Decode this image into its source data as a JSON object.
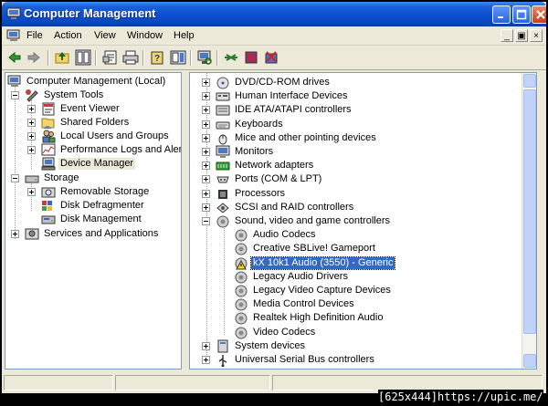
{
  "window": {
    "title": "Computer Management"
  },
  "menu": {
    "items": [
      "File",
      "Action",
      "View",
      "Window",
      "Help"
    ]
  },
  "tree": {
    "root": "Computer Management (Local)",
    "system_tools": "System Tools",
    "event_viewer": "Event Viewer",
    "shared_folders": "Shared Folders",
    "local_users": "Local Users and Groups",
    "perf_logs": "Performance Logs and Alerts",
    "device_manager": "Device Manager",
    "storage": "Storage",
    "removable_storage": "Removable Storage",
    "disk_defrag": "Disk Defragmenter",
    "disk_mgmt": "Disk Management",
    "services_apps": "Services and Applications"
  },
  "devices": {
    "categories": [
      "DVD/CD-ROM drives",
      "Human Interface Devices",
      "IDE ATA/ATAPI controllers",
      "Keyboards",
      "Mice and other pointing devices",
      "Monitors",
      "Network adapters",
      "Ports (COM & LPT)",
      "Processors",
      "SCSI and RAID controllers",
      "Sound, video and game controllers"
    ],
    "sound_children": [
      "Audio Codecs",
      "Creative SBLive! Gameport",
      "kX 10k1 Audio (3550) - Generic",
      "Legacy Audio Drivers",
      "Legacy Video Capture Devices",
      "Media Control Devices",
      "Realtek High Definition Audio",
      "Video Codecs"
    ],
    "after": [
      "System devices",
      "Universal Serial Bus controllers"
    ]
  },
  "watermark": "[625x444]https://upic.me/",
  "icons": [
    "app-icon",
    "minimize-icon",
    "maximize-icon",
    "close-icon",
    "back-icon",
    "forward-icon",
    "up-icon",
    "show-hide-tree-icon",
    "properties-icon",
    "print-icon",
    "help-icon",
    "export-icon",
    "scan-hardware-icon",
    "update-driver-icon",
    "disable-icon",
    "uninstall-icon"
  ],
  "colors": {
    "selection": "#316ac5",
    "titlebar": "#0a4fd0",
    "window": "#ece9d8"
  }
}
